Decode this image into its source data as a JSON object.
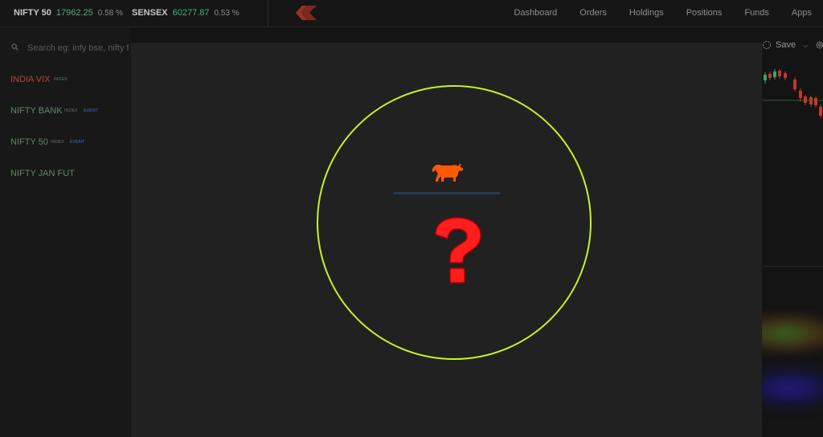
{
  "tickers": [
    {
      "name": "NIFTY 50",
      "value": "17962.25",
      "change": "0.58 %"
    },
    {
      "name": "SENSEX",
      "value": "60277.87",
      "change": "0.53 %"
    }
  ],
  "nav": {
    "dashboard": "Dashboard",
    "orders": "Orders",
    "holdings": "Holdings",
    "positions": "Positions",
    "funds": "Funds",
    "apps": "Apps"
  },
  "search": {
    "placeholder": "Search eg: infy bse, nifty fut"
  },
  "watchlist": [
    {
      "name": "INDIA VIX",
      "tags": [
        "INDEX"
      ]
    },
    {
      "name": "NIFTY BANK",
      "tags": [
        "INDEX",
        "EVENT"
      ]
    },
    {
      "name": "NIFTY 50",
      "tags": [
        "INDEX",
        "EVENT"
      ]
    },
    {
      "name": "NIFTY JAN FUT",
      "tags": []
    }
  ],
  "chart_toolbar": {
    "save_label": "Save"
  },
  "colors": {
    "ring": "#c6f42a",
    "bull": "#ff5a00",
    "question": "#ff1e1e",
    "positive": "#4caf7a",
    "negative": "#b3443c",
    "event_tag": "#3b6fc6"
  },
  "icons": {
    "logo": "kite-logo-icon",
    "search": "search-icon",
    "bull": "bull-icon",
    "question": "question-mark-icon",
    "gear": "gear-icon",
    "clock": "clock-icon"
  }
}
